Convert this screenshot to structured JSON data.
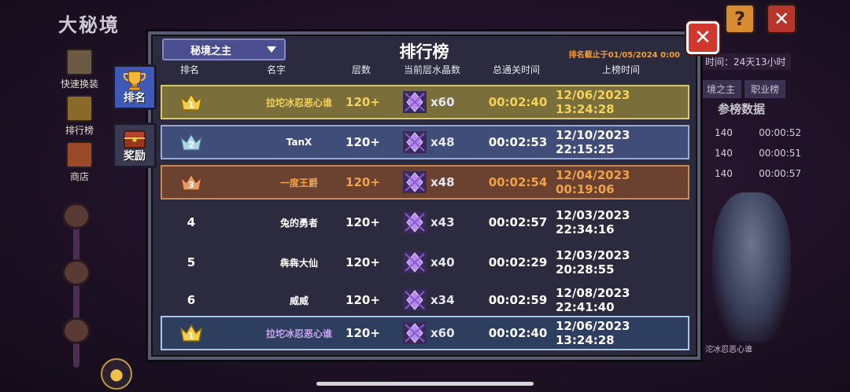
{
  "background": {
    "page_title": "大秘境",
    "side_nav": [
      {
        "label": "快速换装",
        "icon": "swap-gear-icon"
      },
      {
        "label": "排行榜",
        "icon": "trophy-icon"
      },
      {
        "label": "商店",
        "icon": "shop-icon"
      }
    ],
    "help_label": "?",
    "close_label": "✕",
    "right_panel": {
      "time_left": "时间：24天13小时",
      "tabs": [
        "境之主",
        "职业榜"
      ],
      "heading": "参榜数据",
      "rows": [
        {
          "floor": "140",
          "time": "00:00:52"
        },
        {
          "floor": "140",
          "time": "00:00:51"
        },
        {
          "floor": "140",
          "time": "00:00:57"
        }
      ],
      "player_label": "沱冰忍恶心谁"
    }
  },
  "modal": {
    "dropdown_value": "秘境之主",
    "title": "排行榜",
    "cutoff": "排名截止于01/05/2024 0:00",
    "close_label": "✕",
    "side_tabs": [
      {
        "label": "排名",
        "icon": "trophy-icon",
        "selected": true
      },
      {
        "label": "奖励",
        "icon": "treasure-chest-icon",
        "selected": false
      }
    ],
    "columns": [
      "排名",
      "名字",
      "层数",
      "当前层水晶数",
      "总通关时间",
      "上榜时间"
    ],
    "rows": [
      {
        "rank": "1",
        "name": "拉坨冰忍恶心谁",
        "floor": "120+",
        "crystals": "x60",
        "clear_time": "00:02:40",
        "listed_at": "12/06/2023 13:24:28",
        "style": "gold"
      },
      {
        "rank": "2",
        "name": "TanX",
        "floor": "120+",
        "crystals": "x48",
        "clear_time": "00:02:53",
        "listed_at": "12/10/2023 22:15:25",
        "style": "silver"
      },
      {
        "rank": "3",
        "name": "一度王爵",
        "floor": "120+",
        "crystals": "x48",
        "clear_time": "00:02:54",
        "listed_at": "12/04/2023 00:19:06",
        "style": "bronze"
      },
      {
        "rank": "4",
        "name": "兔的勇者",
        "floor": "120+",
        "crystals": "x43",
        "clear_time": "00:02:57",
        "listed_at": "12/03/2023 22:34:16",
        "style": "plain"
      },
      {
        "rank": "5",
        "name": "犇犇大仙",
        "floor": "120+",
        "crystals": "x40",
        "clear_time": "00:02:29",
        "listed_at": "12/03/2023 20:28:55",
        "style": "plain"
      },
      {
        "rank": "6",
        "name": "威威",
        "floor": "120+",
        "crystals": "x34",
        "clear_time": "00:02:59",
        "listed_at": "12/08/2023 22:41:40",
        "style": "plain"
      }
    ],
    "my_row": {
      "rank": "1",
      "name": "拉坨冰忍恶心谁",
      "floor": "120+",
      "crystals": "x60",
      "clear_time": "00:02:40",
      "listed_at": "12/06/2023 13:24:28"
    }
  },
  "colors": {
    "gold": "#f3d35a",
    "bronze": "#f0a24a",
    "accent": "#4b4e8e",
    "close": "#d1372c"
  }
}
